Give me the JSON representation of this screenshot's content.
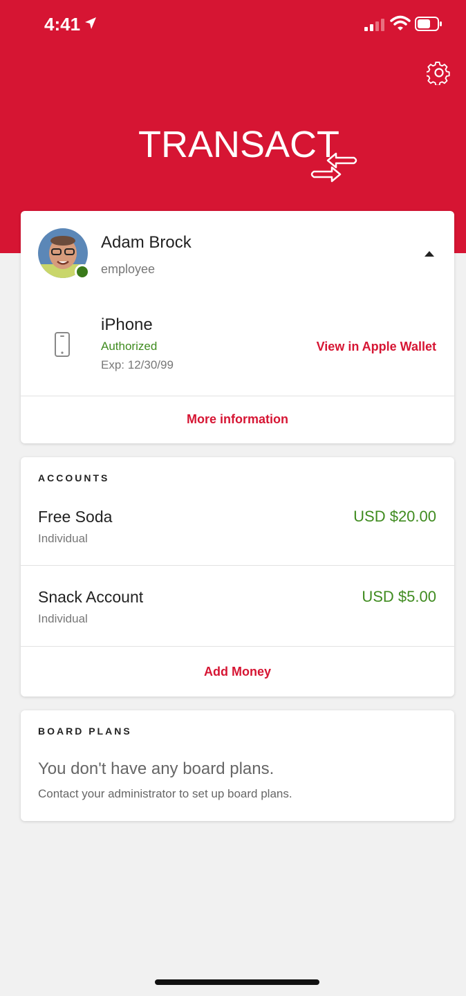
{
  "status_bar": {
    "time": "4:41"
  },
  "header": {
    "brand": "TRANSACT",
    "brand_color": "#d61533"
  },
  "profile": {
    "name": "Adam Brock",
    "role": "employee",
    "device": {
      "name": "iPhone",
      "status": "Authorized",
      "expiry": "Exp: 12/30/99",
      "wallet_link": "View in Apple Wallet"
    },
    "more_info_label": "More information"
  },
  "accounts": {
    "title": "ACCOUNTS",
    "items": [
      {
        "name": "Free Soda",
        "type": "Individual",
        "amount": "USD $20.00"
      },
      {
        "name": "Snack Account",
        "type": "Individual",
        "amount": "USD $5.00"
      }
    ],
    "add_money_label": "Add Money"
  },
  "board_plans": {
    "title": "BOARD PLANS",
    "empty_title": "You don't have any board plans.",
    "empty_subtitle": "Contact your administrator to set up board plans."
  },
  "icons": [
    "location-arrow-icon",
    "signal-icon",
    "wifi-icon",
    "battery-icon",
    "gear-icon",
    "transact-arrows-icon",
    "chevron-up-icon",
    "phone-icon"
  ],
  "colors": {
    "accent_red": "#d61533",
    "positive_green": "#3f8b1f",
    "background": "#f1f1f1"
  }
}
